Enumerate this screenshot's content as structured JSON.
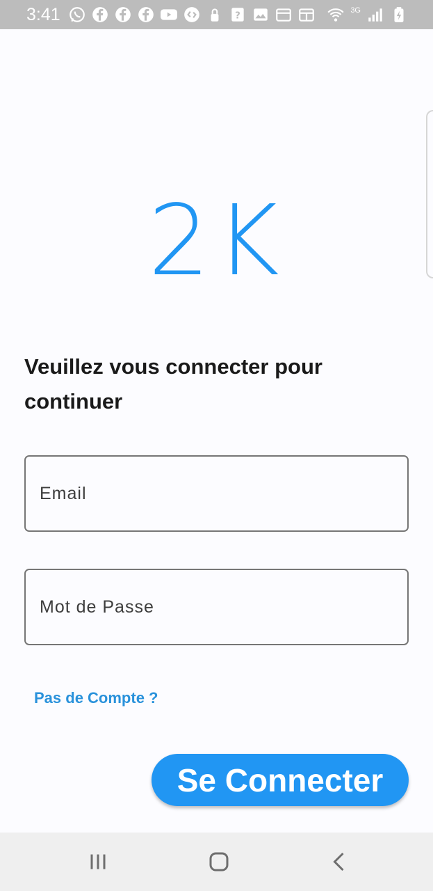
{
  "status_bar": {
    "time": "3:41",
    "notification_icons": [
      "whatsapp-icon",
      "facebook-icon",
      "facebook-icon",
      "facebook-icon",
      "youtube-icon",
      "shazam-icon",
      "lock-icon",
      "help-icon",
      "image-icon",
      "calendar-icon",
      "news-icon"
    ],
    "network_label": "3G",
    "right_icons": [
      "wifi-icon",
      "signal-icon",
      "battery-charging-icon"
    ]
  },
  "app": {
    "logo_text": "2K",
    "prompt": "Veuillez vous connecter pour continuer",
    "email_placeholder": "Email",
    "password_placeholder": "Mot de Passe",
    "signup_link": "Pas de Compte ?",
    "login_button": "Se Connecter",
    "brand_color": "#2196f3"
  },
  "nav_bar": {
    "buttons": [
      "recents-icon",
      "home-icon",
      "back-icon"
    ]
  }
}
